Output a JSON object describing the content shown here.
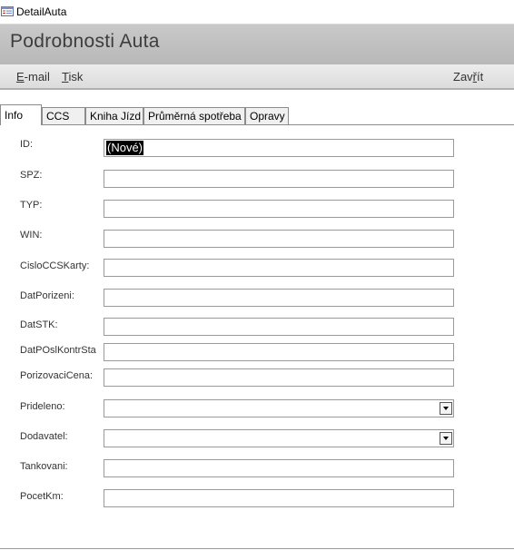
{
  "window": {
    "title": "DetailAuta",
    "icon": "form-icon"
  },
  "header": {
    "heading": "Podrobnosti Auta"
  },
  "toolbar": {
    "email": {
      "mnemonic": "E",
      "rest": "-mail"
    },
    "print": {
      "mnemonic": "T",
      "rest": "isk"
    },
    "close": {
      "pre": "Zav",
      "mnemonic": "ř",
      "rest": "ít"
    }
  },
  "tabs": [
    "Info",
    "CCS",
    "Kniha Jízd",
    "Průměrná spotřeba",
    "Opravy"
  ],
  "form": {
    "fields": [
      {
        "label": "ID:",
        "value": "(Nové)"
      },
      {
        "label": "SPZ:",
        "value": ""
      },
      {
        "label": "TYP:",
        "value": ""
      },
      {
        "label": "WIN:",
        "value": ""
      },
      {
        "label": "CisloCCSKarty:",
        "value": ""
      },
      {
        "label": "DatPorizeni:",
        "value": ""
      },
      {
        "label": "DatSTK:",
        "value": ""
      },
      {
        "label": "DatPOslKontrSta",
        "value": ""
      },
      {
        "label": "PorizovaciCena:",
        "value": ""
      },
      {
        "label": "Prideleno:",
        "value": ""
      },
      {
        "label": "Dodavatel:",
        "value": ""
      },
      {
        "label": "Tankovani:",
        "value": ""
      },
      {
        "label": "PocetKm:",
        "value": ""
      }
    ]
  }
}
